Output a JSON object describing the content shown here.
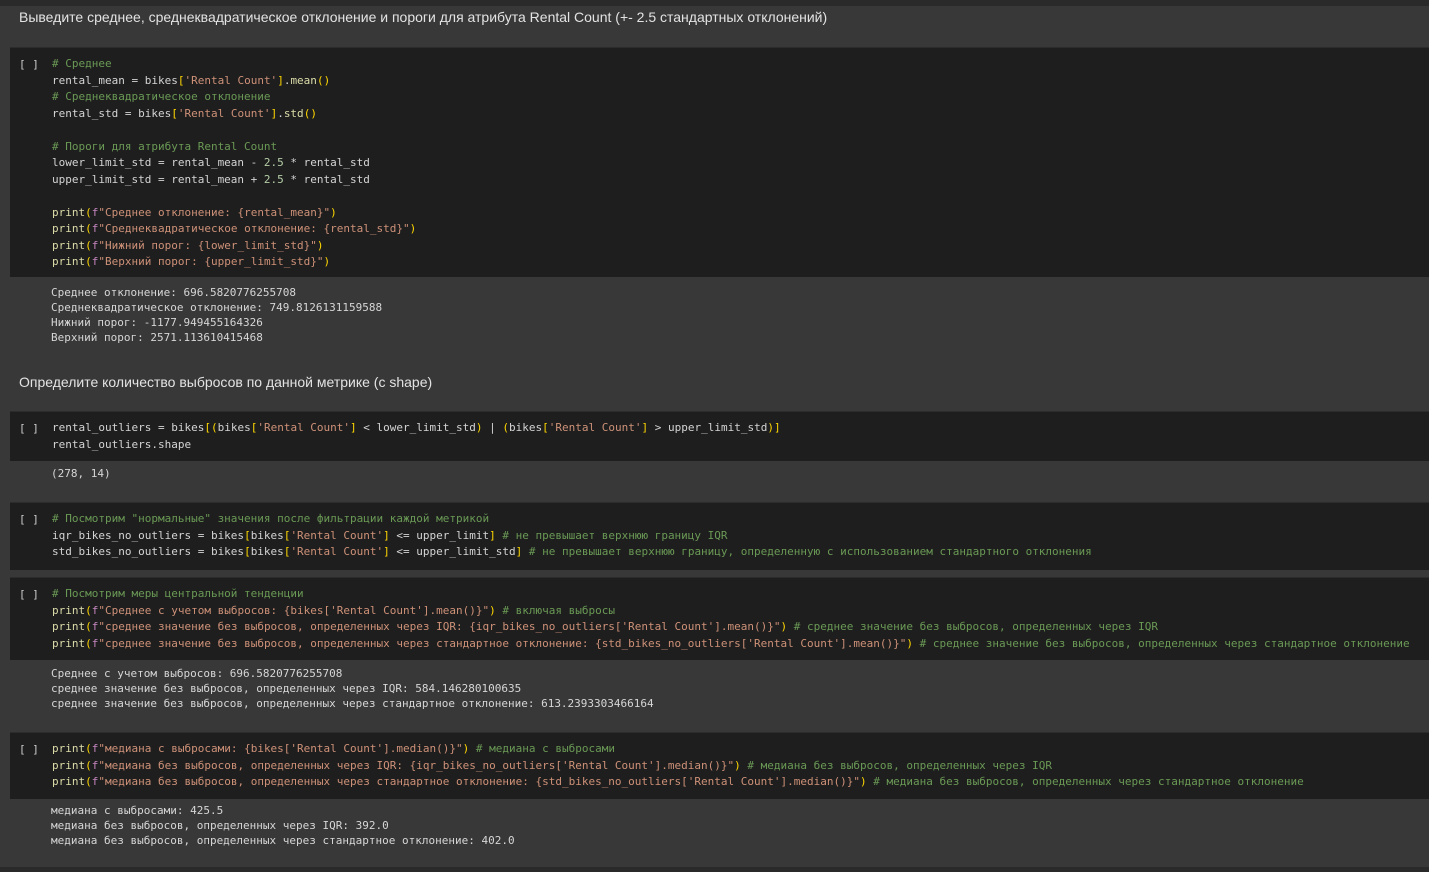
{
  "md1": "Выведите среднее, среднеквадратическое отклонение и пороги для атрибута Rental Count (+- 2.5 стандартных отклонений)",
  "md2": "Определите количество выбросов по данной метрике (с shape)",
  "run_label": "[ ]",
  "cell1": {
    "lines": [
      "# Среднее",
      "rental_mean = bikes['Rental Count'].mean()",
      "# Среднеквадратическое отклонение",
      "rental_std = bikes['Rental Count'].std()",
      "",
      "# Пороги для атрибута Rental Count",
      "lower_limit_std = rental_mean - 2.5 * rental_std",
      "upper_limit_std = rental_mean + 2.5 * rental_std",
      "",
      "print(f\"Среднее отклонение: {rental_mean}\")",
      "print(f\"Среднеквадратическое отклонение: {rental_std}\")",
      "print(f\"Нижний порог: {lower_limit_std}\")",
      "print(f\"Верхний порог: {upper_limit_std}\")"
    ],
    "output": [
      "Среднее отклонение: 696.5820776255708",
      "Среднеквадратическое отклонение: 749.8126131159588",
      "Нижний порог: -1177.949455164326",
      "Верхний порог: 2571.113610415468"
    ]
  },
  "cell2": {
    "lines": [
      "rental_outliers = bikes[(bikes['Rental Count'] < lower_limit_std) | (bikes['Rental Count'] > upper_limit_std)]",
      "rental_outliers.shape"
    ],
    "output": [
      "(278, 14)"
    ]
  },
  "cell3": {
    "lines": [
      "# Посмотрим \"нормальные\" значения после фильтрации каждой метрикой",
      "iqr_bikes_no_outliers = bikes[bikes['Rental Count'] <= upper_limit] # не превышает верхнюю границу IQR",
      "std_bikes_no_outliers = bikes[bikes['Rental Count'] <= upper_limit_std] # не превышает верхнюю границу, определенную с использованием стандартного отклонения"
    ]
  },
  "cell4": {
    "lines": [
      "# Посмотрим меры центральной тенденции",
      "print(f\"Среднее с учетом выбросов: {bikes['Rental Count'].mean()}\") # включая выбросы",
      "print(f\"среднее значение без выбросов, определенных через IQR: {iqr_bikes_no_outliers['Rental Count'].mean()}\") # среднее значение без выбросов, определенных через IQR",
      "print(f\"среднее значение без выбросов, определенных через стандартное отклонение: {std_bikes_no_outliers['Rental Count'].mean()}\") # среднее значение без выбросов, определенных через стандартное отклонение"
    ],
    "output": [
      "Среднее с учетом выбросов: 696.5820776255708",
      "среднее значение без выбросов, определенных через IQR: 584.146280100635",
      "среднее значение без выбросов, определенных через стандартное отклонение: 613.2393303466164"
    ]
  },
  "cell5": {
    "lines": [
      "print(f\"медиана с выбросами: {bikes['Rental Count'].median()}\") # медиана с выбросами",
      "print(f\"медиана без выбросов, определенных через IQR: {iqr_bikes_no_outliers['Rental Count'].median()}\") # медиана без выбросов, определенных через IQR",
      "print(f\"медиана без выбросов, определенных через стандартное отклонение: {std_bikes_no_outliers['Rental Count'].median()}\") # медиана без выбросов, определенных через стандартное отклонение"
    ],
    "output": [
      "медиана с выбросами: 425.5",
      "медиана без выбросов, определенных через IQR: 392.0",
      "медиана без выбросов, определенных через стандартное отклонение: 402.0"
    ]
  }
}
